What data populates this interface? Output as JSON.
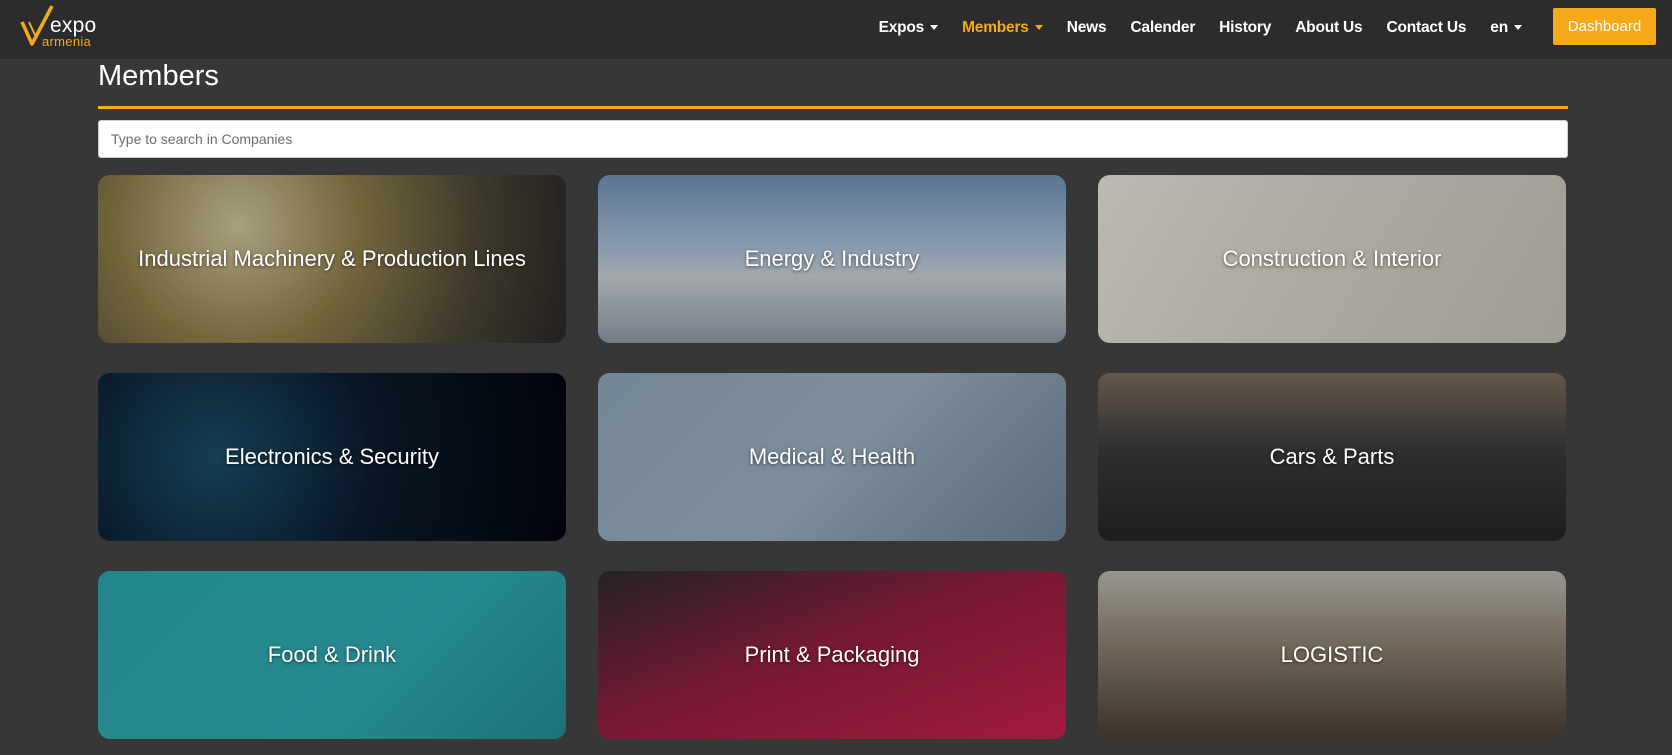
{
  "brand": {
    "logo_top": "expo",
    "logo_bottom": "armenia",
    "accent": "#f5a818"
  },
  "nav": {
    "items": [
      {
        "label": "Expos",
        "dropdown": true,
        "active": false
      },
      {
        "label": "Members",
        "dropdown": true,
        "active": true
      },
      {
        "label": "News",
        "dropdown": false,
        "active": false
      },
      {
        "label": "Calender",
        "dropdown": false,
        "active": false
      },
      {
        "label": "History",
        "dropdown": false,
        "active": false
      },
      {
        "label": "About Us",
        "dropdown": false,
        "active": false
      },
      {
        "label": "Contact Us",
        "dropdown": false,
        "active": false
      },
      {
        "label": "en",
        "dropdown": true,
        "active": false
      }
    ],
    "dashboard_label": "Dashboard"
  },
  "page": {
    "title": "Members",
    "search_placeholder": "Type to search in Companies"
  },
  "categories": [
    {
      "label": "Industrial Machinery & Production Lines"
    },
    {
      "label": "Energy & Industry"
    },
    {
      "label": "Construction & Interior"
    },
    {
      "label": "Electronics & Security"
    },
    {
      "label": "Medical & Health"
    },
    {
      "label": "Cars & Parts"
    },
    {
      "label": "Food & Drink"
    },
    {
      "label": "Print & Packaging"
    },
    {
      "label": "LOGISTIC"
    }
  ]
}
